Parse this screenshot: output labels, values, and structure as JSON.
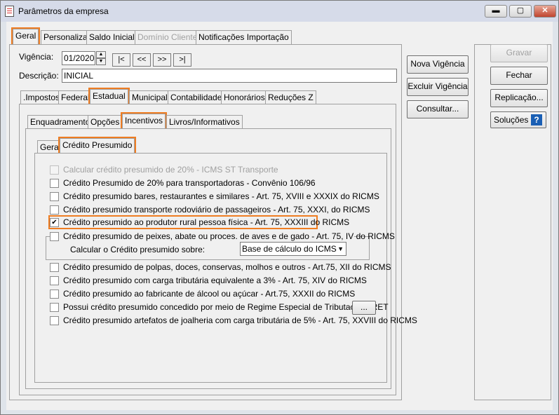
{
  "window": {
    "title": "Parâmetros da empresa",
    "minimize": "▬",
    "maximize": "▢",
    "close": "✕"
  },
  "main_tabs": [
    "Geral",
    "Personaliza",
    "Saldo Inicial",
    "Domínio Cliente",
    "Notificações Importação"
  ],
  "vigencia": {
    "label": "Vigência:",
    "value": "01/2020",
    "nav": [
      "|<",
      "<<",
      ">>",
      ">|"
    ]
  },
  "descricao": {
    "label": "Descrição:",
    "value": "INICIAL"
  },
  "sub_tabs": [
    ".Impostos",
    "Federal",
    "Estadual",
    "Municipal",
    "Contabilidade",
    "Honorários",
    "Reduções Z"
  ],
  "estadual_tabs": [
    "Enquadramento",
    "Opções",
    "Incentivos",
    "Livros/Informativos"
  ],
  "incentivos_tabs": [
    "Geral",
    "Crédito Presumido"
  ],
  "checkboxes": [
    {
      "label": "Calcular crédito presumido de 20% - ICMS ST Transporte",
      "checked": false,
      "disabled": true
    },
    {
      "label": "Crédito Presumido de 20% para transportadoras - Convênio 106/96",
      "checked": false,
      "disabled": false
    },
    {
      "label": "Crédito presumido bares, restaurantes e similares - Art. 75, XVIII e XXXIX do RICMS",
      "checked": false,
      "disabled": false
    },
    {
      "label": "Crédito presumido transporte rodoviário de passageiros - Art. 75, XXXI, do RICMS",
      "checked": false,
      "disabled": false
    },
    {
      "label": "Crédito presumido ao produtor rural pessoa física - Art. 75, XXXIII do RICMS",
      "checked": true,
      "disabled": false
    },
    {
      "label": "Crédito presumido de peixes, abate ou proces. de aves e de gado - Art. 75, IV do RICMS",
      "checked": false,
      "disabled": false
    },
    {
      "label": "Crédito presumido de polpas, doces, conservas, molhos e outros - Art.75, XII do RICMS",
      "checked": false,
      "disabled": false
    },
    {
      "label": "Crédito presumido com carga tributária equivalente a 3% - Art. 75, XIV do RICMS",
      "checked": false,
      "disabled": false
    },
    {
      "label": "Crédito presumido ao fabricante de álcool ou açúcar - Art.75, XXXII do RICMS",
      "checked": false,
      "disabled": false
    },
    {
      "label": "Possui crédito presumido concedido por meio de Regime Especial de Tributação - RET",
      "checked": false,
      "disabled": false
    },
    {
      "label": "Crédito presumido artefatos de joalheria com carga tributária de 5% - Art. 75, XXVIII do RICMS",
      "checked": false,
      "disabled": false
    }
  ],
  "calcular_sobre": {
    "label": "Calcular o Crédito presumido sobre:",
    "value": "Base de cálculo do ICMS"
  },
  "ret_button": "...",
  "right_buttons": {
    "nova_vigencia": "Nova Vigência",
    "excluir_vigencia": "Excluir Vigência",
    "consultar": "Consultar..."
  },
  "side_buttons": {
    "gravar": "Gravar",
    "fechar": "Fechar",
    "replicacao": "Replicação...",
    "solucoes": "Soluções",
    "help": "?"
  },
  "colors": {
    "highlight": "#ef7d22",
    "help_icon": "#1a5fb4"
  }
}
